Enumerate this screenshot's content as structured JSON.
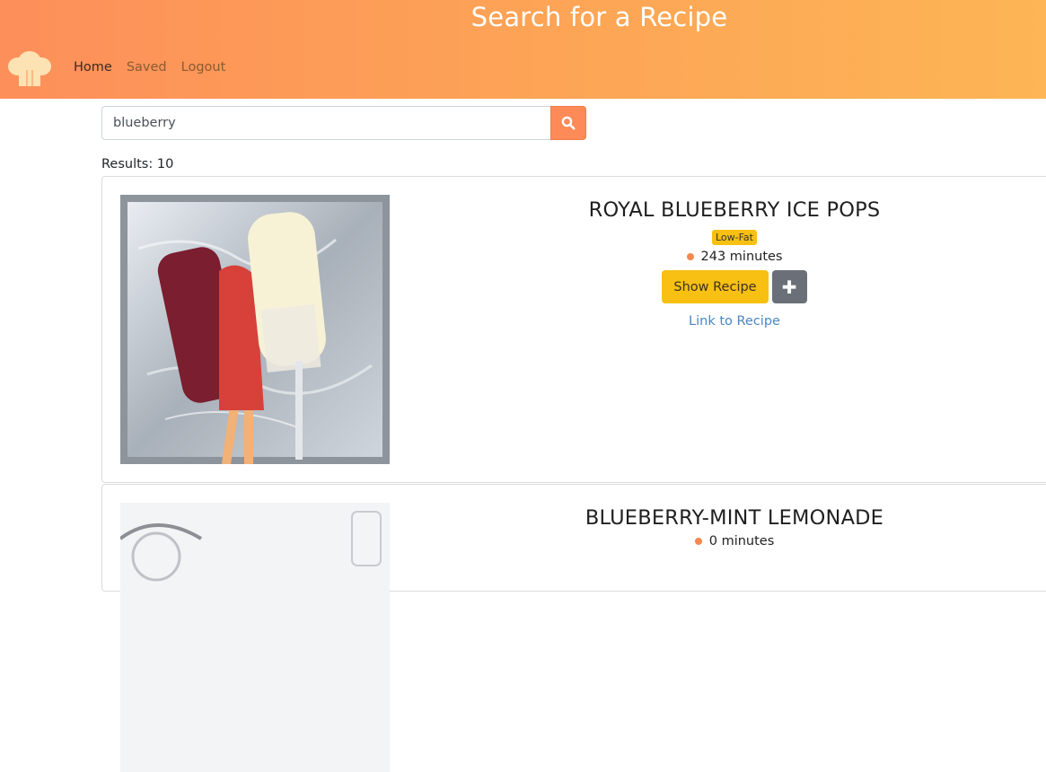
{
  "header": {
    "title": "Search for a Recipe",
    "logo_icon": "chef-hat-icon",
    "nav": {
      "home": "Home",
      "saved": "Saved",
      "logout": "Logout"
    }
  },
  "search": {
    "value": "blueberry",
    "button_icon": "search-icon"
  },
  "results_label": "Results: 10",
  "recipes": [
    {
      "title": "ROYAL BLUEBERRY ICE POPS",
      "badge": "Low-Fat",
      "time": "243 minutes",
      "show_label": "Show Recipe",
      "add_label": "✚",
      "link_label": "Link to Recipe"
    },
    {
      "title": "BLUEBERRY-MINT LEMONADE",
      "time": "0 minutes"
    }
  ],
  "colors": {
    "accent": "#fd8a57",
    "badge": "#f7c012",
    "link": "#4a86c5"
  }
}
